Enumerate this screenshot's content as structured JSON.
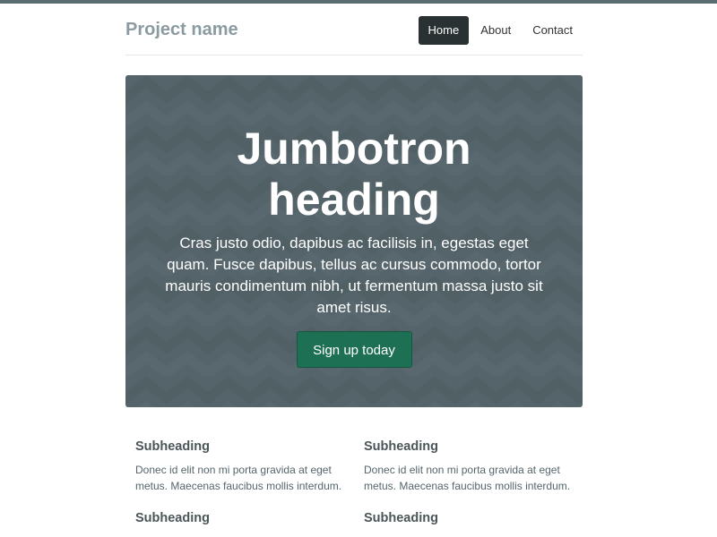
{
  "header": {
    "brand": "Project name",
    "nav": [
      {
        "label": "Home",
        "active": true
      },
      {
        "label": "About",
        "active": false
      },
      {
        "label": "Contact",
        "active": false
      }
    ]
  },
  "jumbotron": {
    "heading": "Jumbotron heading",
    "lead": "Cras justo odio, dapibus ac facilisis in, egestas eget quam. Fusce dapibus, tellus ac cursus commodo, tortor mauris condimentum nibh, ut fermentum massa justo sit amet risus.",
    "button_label": "Sign up today"
  },
  "marketing": [
    {
      "title": "Subheading",
      "text": "Donec id elit non mi porta gravida at eget metus. Maecenas faucibus mollis interdum."
    },
    {
      "title": "Subheading",
      "text": "Donec id elit non mi porta gravida at eget metus. Maecenas faucibus mollis interdum."
    },
    {
      "title": "Subheading",
      "text": ""
    },
    {
      "title": "Subheading",
      "text": ""
    }
  ],
  "colors": {
    "top_bar": "#5a6b70",
    "brand": "#8a9ba1",
    "nav_active_bg": "#2a3133",
    "jumbotron_bg": "#55646a",
    "button_bg": "#1e7055",
    "heading_text": "#4b5659"
  }
}
